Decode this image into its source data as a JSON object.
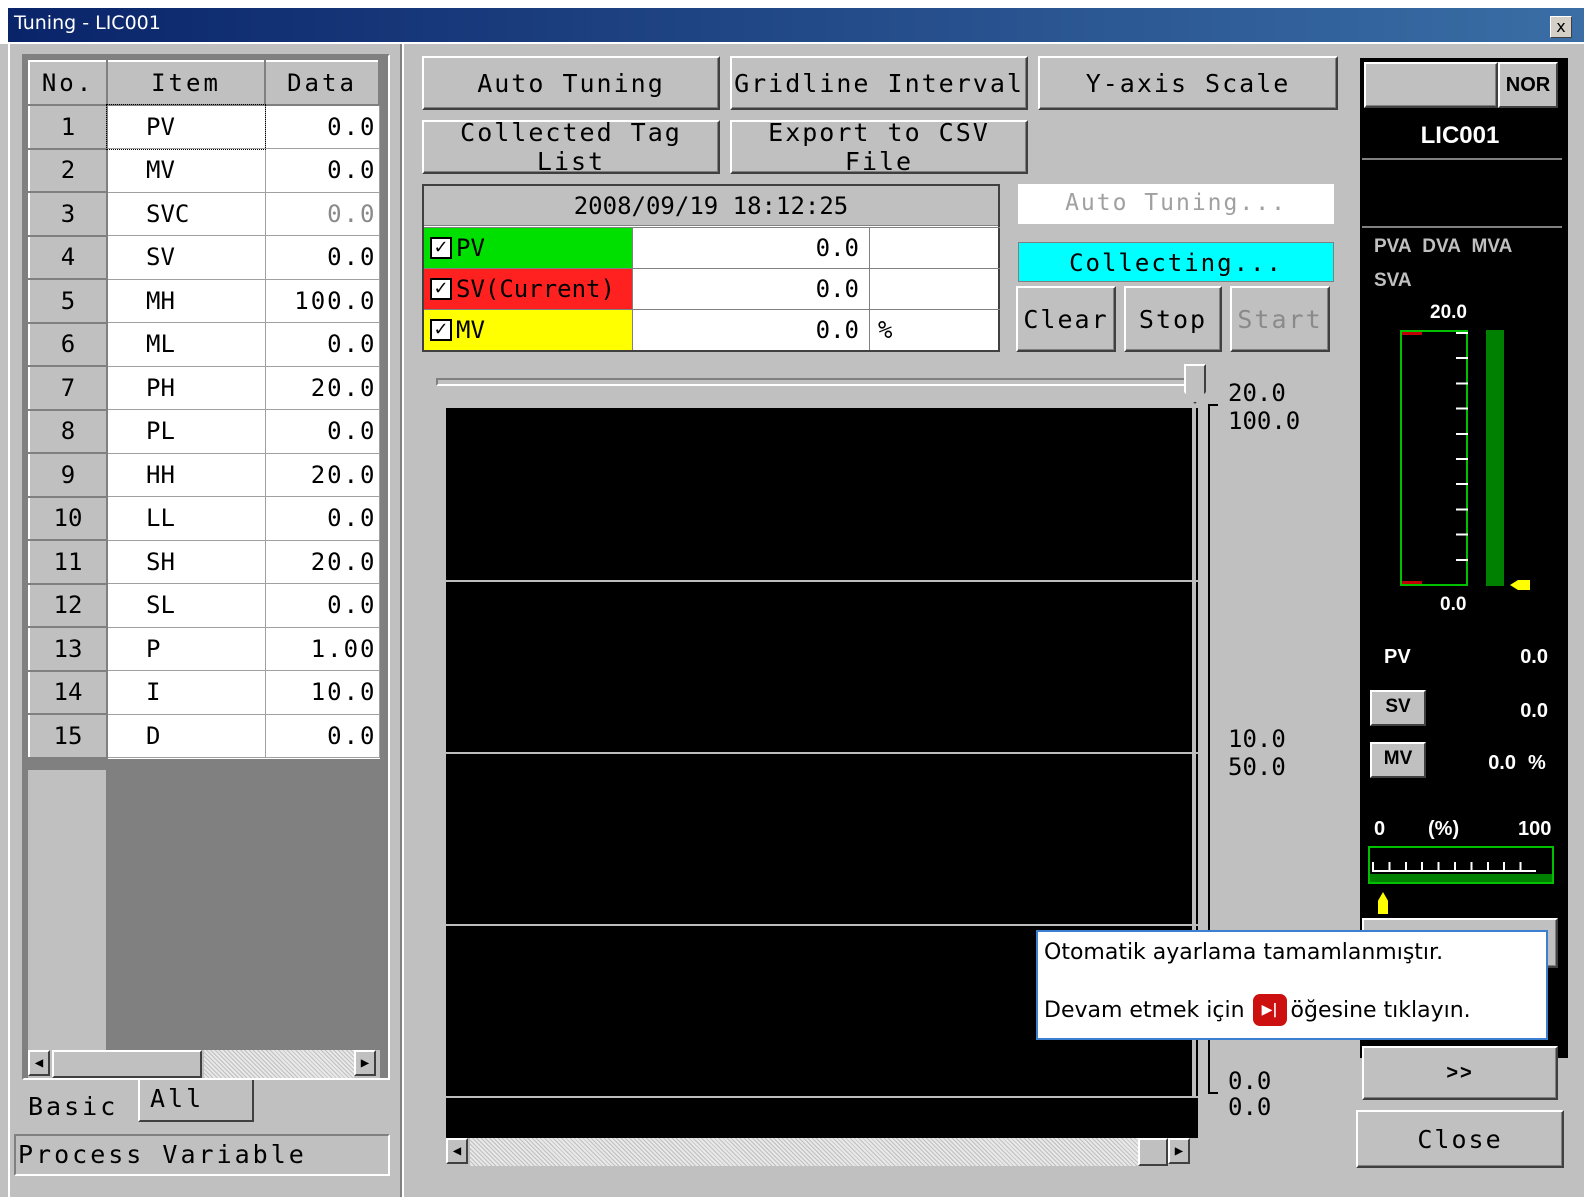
{
  "window": {
    "title": "Tuning - LIC001",
    "close_label": "x"
  },
  "params": {
    "headers": [
      "No.",
      "Item",
      "Data"
    ],
    "rows": [
      {
        "no": "1",
        "item": "PV",
        "data": "0.0"
      },
      {
        "no": "2",
        "item": "MV",
        "data": "0.0"
      },
      {
        "no": "3",
        "item": "SVC",
        "data": "0.0"
      },
      {
        "no": "4",
        "item": "SV",
        "data": "0.0"
      },
      {
        "no": "5",
        "item": "MH",
        "data": "100.0"
      },
      {
        "no": "6",
        "item": "ML",
        "data": "0.0"
      },
      {
        "no": "7",
        "item": "PH",
        "data": "20.0"
      },
      {
        "no": "8",
        "item": "PL",
        "data": "0.0"
      },
      {
        "no": "9",
        "item": "HH",
        "data": "20.0"
      },
      {
        "no": "10",
        "item": "LL",
        "data": "0.0"
      },
      {
        "no": "11",
        "item": "SH",
        "data": "20.0"
      },
      {
        "no": "12",
        "item": "SL",
        "data": "0.0"
      },
      {
        "no": "13",
        "item": "P",
        "data": "1.00"
      },
      {
        "no": "14",
        "item": "I",
        "data": "10.0"
      },
      {
        "no": "15",
        "item": "D",
        "data": "0.0"
      }
    ],
    "tabs": {
      "basic": "Basic",
      "all": "All"
    },
    "description": "Process Variable"
  },
  "toolbar": {
    "auto_tuning": "Auto Tuning",
    "gridline_interval": "Gridline Interval",
    "y_axis_scale": "Y-axis Scale",
    "collected_tag_list": "Collected Tag List",
    "export_csv": "Export to CSV File"
  },
  "legend": {
    "timestamp": "2008/09/19 18:12:25",
    "rows": [
      {
        "name": "PV",
        "value": "0.0",
        "unit": "",
        "color": "#00e000"
      },
      {
        "name": "SV(Current)",
        "value": "0.0",
        "unit": "",
        "color": "#ff2020"
      },
      {
        "name": "MV",
        "value": "0.0",
        "unit": "%",
        "color": "#ffff00"
      }
    ]
  },
  "status": {
    "auto_tuning": "Auto Tuning...",
    "collecting": "Collecting...",
    "clear": "Clear",
    "stop": "Stop",
    "start": "Start"
  },
  "trend": {
    "left_axis": {
      "top": "20.0",
      "mid": "10.0",
      "bottom": "0.0"
    },
    "right_axis": {
      "top": "100.0",
      "mid": "50.0",
      "bottom": "0.0"
    },
    "slider_position": 1.0,
    "background": "#000000"
  },
  "faceplate": {
    "mode": "NOR",
    "tag": "LIC001",
    "alarm_line1": "PVA DVA MVA",
    "alarm_line2": "SVA",
    "bar_top": "20.0",
    "bar_bottom": "0.0",
    "pv_label": "PV",
    "pv_value": "0.0",
    "sv_label": "SV",
    "sv_value": "0.0",
    "mv_label": "MV",
    "mv_value": "0.0",
    "mv_unit": "%",
    "scale_min": "0",
    "scale_unit": "(%)",
    "scale_max": "100",
    "mv_level": 0.0,
    "pv_level": 0.0
  },
  "buttons": {
    "more": ">>",
    "close": "Close"
  },
  "tooltip": {
    "line1": "Otomatik ayarlama tamamlanmıştır.",
    "line2_before": "Devam etmek için",
    "line2_after": "öğesine tıklayın."
  }
}
